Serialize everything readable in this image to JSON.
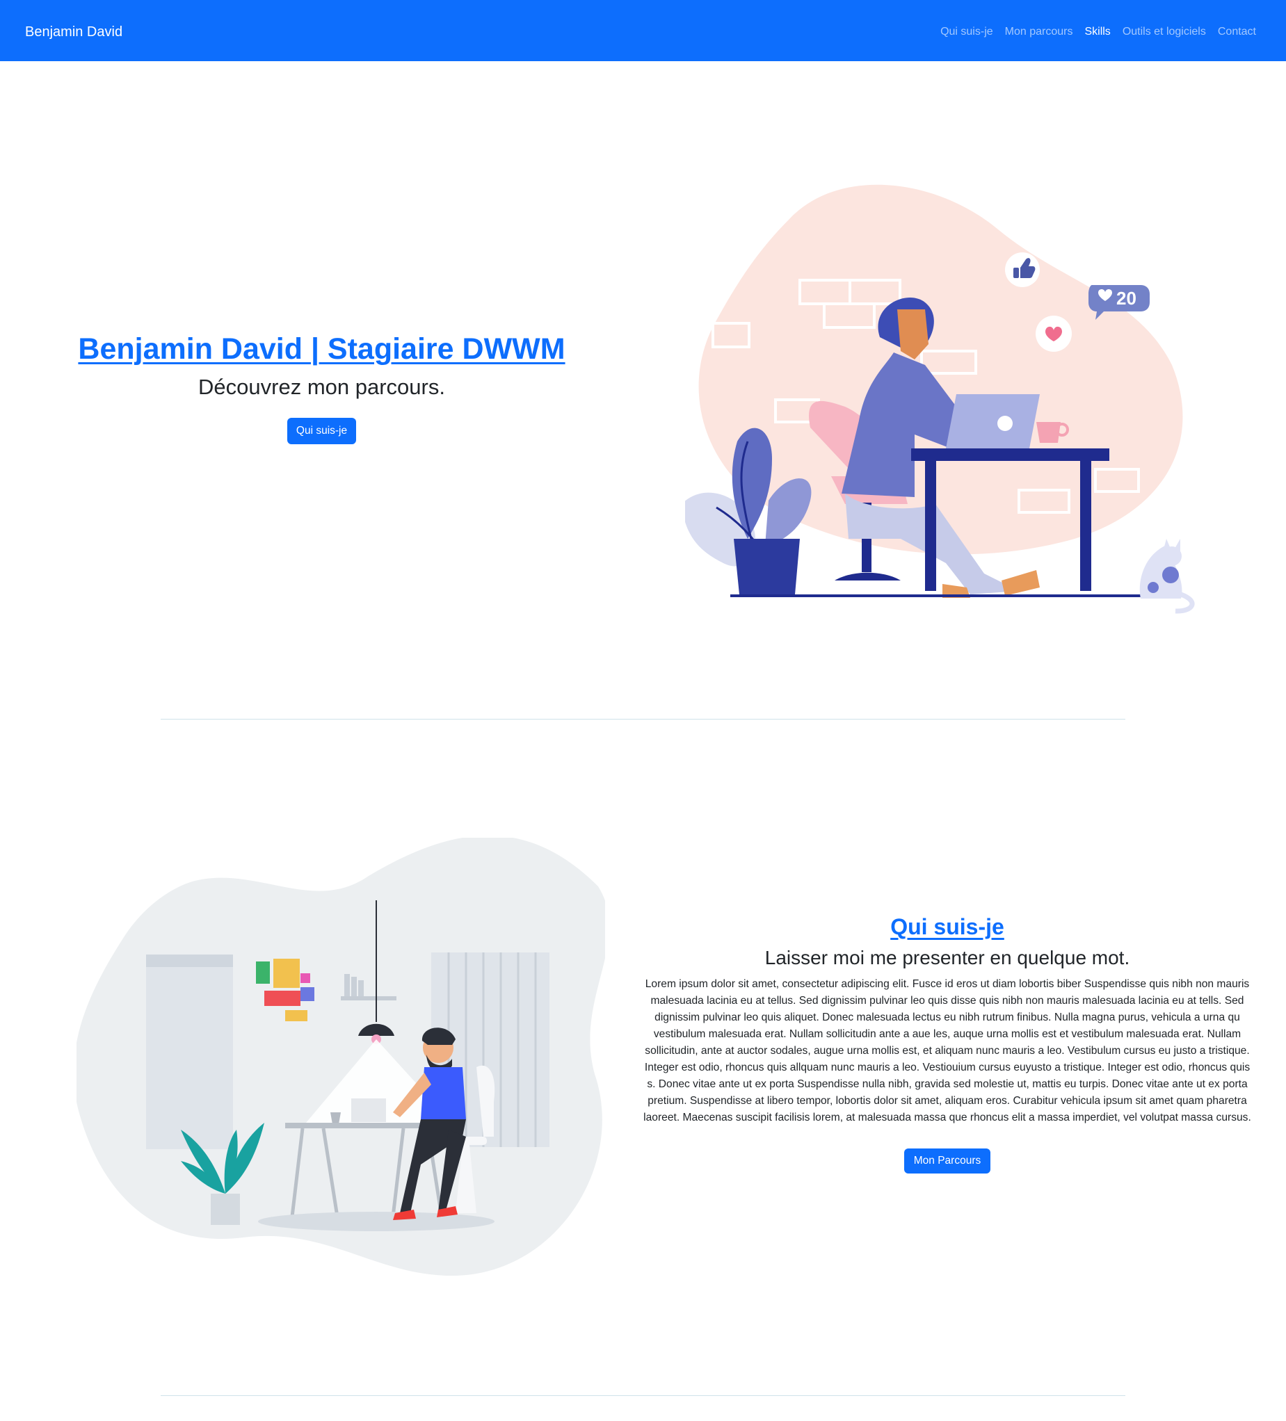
{
  "navbar": {
    "brand": "Benjamin David",
    "links": [
      "Qui suis-je",
      "Mon parcours",
      "Skills",
      "Outils et logiciels",
      "Contact"
    ]
  },
  "hero": {
    "title": "Benjamin David | Stagiaire DWWM",
    "subtitle": "Découvrez mon parcours.",
    "button_label": "Qui suis-je",
    "illustration": {
      "notification_count": "20",
      "icons": [
        "thumbs-up-icon",
        "heart-icon"
      ]
    }
  },
  "about": {
    "title": "Qui suis-je",
    "subtitle": "Laisser moi me presenter en quelque mot.",
    "body": "Lorem ipsum dolor sit amet, consectetur adipiscing elit. Fusce id eros ut diam lobortis biber Suspendisse quis nibh non mauris malesuada lacinia eu at tellus. Sed dignissim pulvinar leo quis disse quis nibh non mauris malesuada lacinia eu at tells. Sed dignissim pulvinar leo quis aliquet. Donec malesuada lectus eu nibh rutrum finibus. Nulla magna purus, vehicula a urna qu vestibulum malesuada erat. Nullam sollicitudin ante a aue les, auque urna mollis est et vestibulum malesuada erat. Nullam sollicitudin, ante at auctor sodales, augue urna mollis est, et aliquam nunc mauris a leo. Vestibulum cursus eu justo a tristique. Integer est odio, rhoncus quis allquam nunc mauris a leo. Vestiouium cursus euyusto a tristique. Integer est odio, rhoncus quis s. Donec vitae ante ut ex porta Suspendisse nulla nibh, gravida sed molestie ut, mattis eu turpis. Donec vitae ante ut ex porta pretium. Suspendisse at libero tempor, lobortis dolor sit amet, aliquam eros. Curabitur vehicula ipsum sit amet quam pharetra laoreet. Maecenas suscipit facilisis lorem, at malesuada massa que rhoncus elit a massa imperdiet, vel volutpat massa cursus.",
    "button_label": "Mon Parcours"
  },
  "colors": {
    "primary": "#0d6efd",
    "text": "#212529",
    "divider": "#cfe3ea",
    "hero_blob": "#fce5df",
    "about_blob": "#eceff1"
  }
}
